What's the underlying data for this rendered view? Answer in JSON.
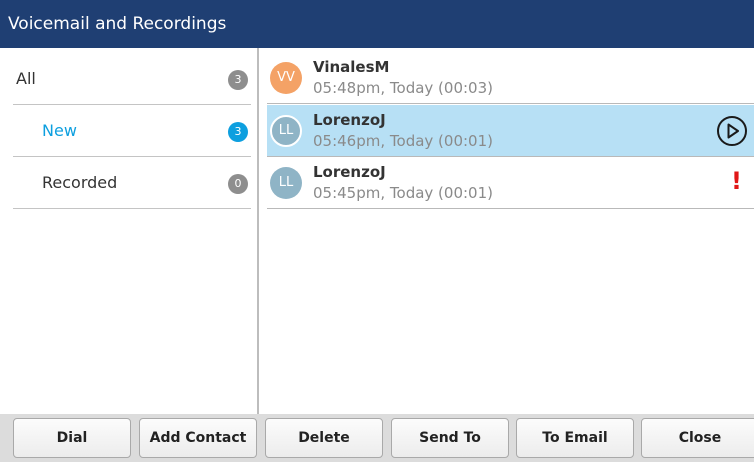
{
  "window": {
    "title": "Voicemail and Recordings"
  },
  "sidebar": {
    "items": [
      {
        "label": "All",
        "count": "3",
        "active": false
      },
      {
        "label": "New",
        "count": "3",
        "active": true
      },
      {
        "label": "Recorded",
        "count": "0",
        "active": false
      }
    ]
  },
  "messages": [
    {
      "initials": "VV",
      "name": "VinalesM",
      "meta": "05:48pm, Today (00:03)",
      "avatar_color": "#f4a266",
      "selected": false,
      "icon": "none"
    },
    {
      "initials": "LL",
      "name": "LorenzoJ",
      "meta": "05:46pm, Today (00:01)",
      "avatar_color": "#8fb4c6",
      "selected": true,
      "icon": "play-icon"
    },
    {
      "initials": "LL",
      "name": "LorenzoJ",
      "meta": "05:45pm, Today (00:01)",
      "avatar_color": "#8fb4c6",
      "selected": false,
      "icon": "alert-icon",
      "alert_text": "!"
    }
  ],
  "softkeys": {
    "dial": "Dial",
    "add_contact": "Add Contact",
    "delete": "Delete",
    "send_to": "Send To",
    "to_email": "To Email",
    "close": "Close"
  },
  "colors": {
    "titlebar": "#1f3f73",
    "active_accent": "#0d9fdf",
    "selected_row": "#b7e0f5",
    "badge_inactive": "#8e8e8e",
    "alert": "#e01717"
  }
}
